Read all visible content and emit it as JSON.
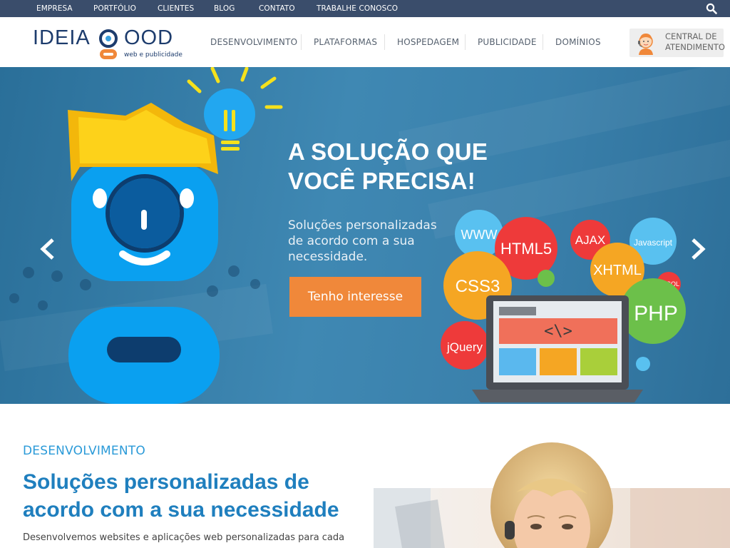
{
  "topbar": {
    "links": [
      "EMPRESA",
      "PORTFÓLIO",
      "CLIENTES",
      "BLOG",
      "CONTATO",
      "TRABALHE CONOSCO"
    ],
    "search_icon": "search-icon"
  },
  "header": {
    "logo_text": "IDEIA OOOD",
    "logo_tagline": "web e publicidade",
    "nav": [
      "DESENVOLVIMENTO",
      "PLATAFORMAS",
      "HOSPEDAGEM",
      "PUBLICIDADE",
      "DOMÍNIOS"
    ],
    "central_line1": "CENTRAL DE",
    "central_line2": "ATENDIMENTO"
  },
  "hero": {
    "title_line1": "A SOLUÇÃO QUE",
    "title_line2": "VOCÊ PRECISA!",
    "subtitle": "Soluções personalizadas de acordo com a sua necessidade.",
    "cta": "Tenho interesse",
    "tech_bubbles": [
      "WWW",
      "HTML5",
      "AJAX",
      "Javascript",
      "CSS3",
      "XHTML",
      "MySQL",
      "PHP",
      "jQuery"
    ],
    "laptop_code": "<\\>"
  },
  "section": {
    "eyebrow": "DESENVOLVIMENTO",
    "title": "Soluções personalizadas de acordo com a sua necessidade",
    "text": "Desenvolvemos websites e aplicações web personalizadas para cada"
  },
  "colors": {
    "topbar": "#3a4d6b",
    "accent_orange": "#f0883a",
    "brand_blue": "#1d3c6d",
    "section_blue": "#1f7fbe"
  }
}
